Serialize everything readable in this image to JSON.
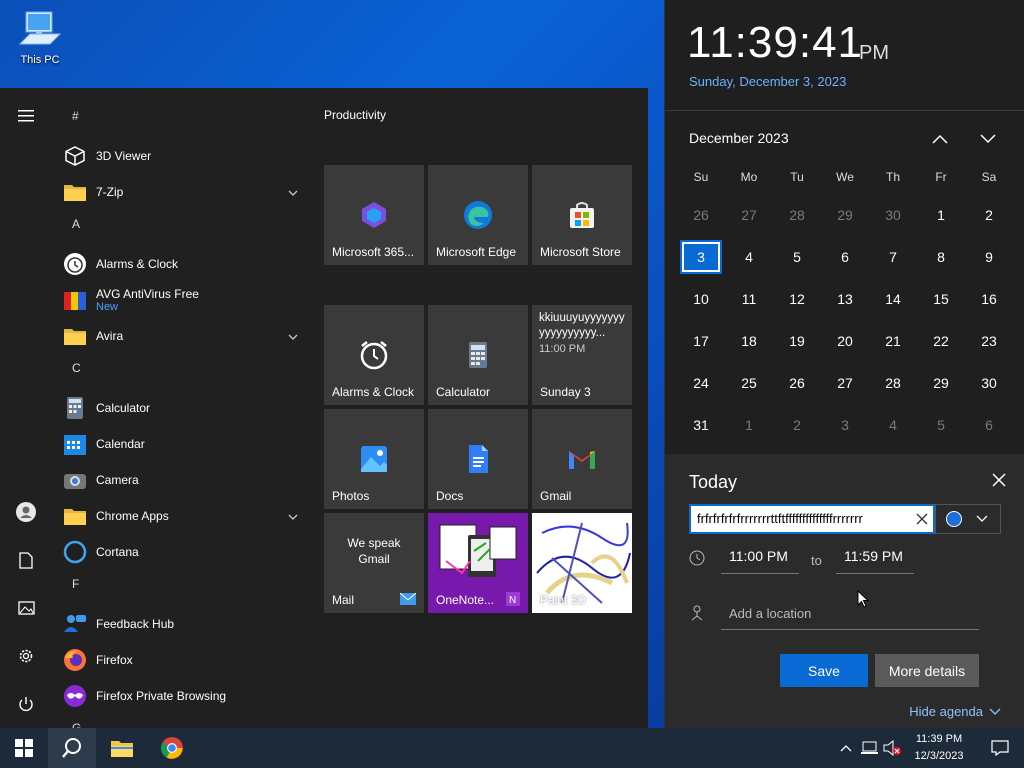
{
  "desktop": {
    "icon_label": "This PC"
  },
  "start_menu": {
    "groups": [
      {
        "letter": "#",
        "apps": [
          {
            "label": "3D Viewer",
            "icon": "cube-icon"
          },
          {
            "label": "7-Zip",
            "icon": "folder-icon",
            "expandable": true
          }
        ]
      },
      {
        "letter": "A",
        "apps": [
          {
            "label": "Alarms & Clock",
            "icon": "alarm-clock-icon"
          },
          {
            "label": "AVG AntiVirus Free",
            "sublabel": "New",
            "icon": "avg-icon"
          },
          {
            "label": "Avira",
            "icon": "folder-icon",
            "expandable": true
          }
        ]
      },
      {
        "letter": "C",
        "apps": [
          {
            "label": "Calculator",
            "icon": "calculator-icon"
          },
          {
            "label": "Calendar",
            "icon": "calendar-icon"
          },
          {
            "label": "Camera",
            "icon": "camera-icon"
          },
          {
            "label": "Chrome Apps",
            "icon": "folder-icon",
            "expandable": true
          },
          {
            "label": "Cortana",
            "icon": "cortana-icon"
          }
        ]
      },
      {
        "letter": "F",
        "apps": [
          {
            "label": "Feedback Hub",
            "icon": "feedback-icon"
          },
          {
            "label": "Firefox",
            "icon": "firefox-icon"
          },
          {
            "label": "Firefox Private Browsing",
            "icon": "firefox-private-icon"
          }
        ]
      },
      {
        "letter": "G",
        "apps": []
      }
    ],
    "tiles_group_title": "Productivity",
    "tiles": {
      "m365": "Microsoft 365...",
      "edge": "Microsoft Edge",
      "store": "Microsoft Store",
      "alarms": "Alarms & Clock",
      "calculator": "Calculator",
      "cal_event_title": "kkiuuuyuyyyyyyyyyyyyyyyyy...",
      "cal_event_time": "11:00 PM",
      "cal_day": "Sunday 3",
      "photos": "Photos",
      "docs": "Docs",
      "gmail": "Gmail",
      "mail_promo": "We speak Gmail",
      "mail": "Mail",
      "onenote": "OneNote...",
      "paint3d": "Paint 3D"
    }
  },
  "clock": {
    "time": "11:39:41",
    "ampm": "PM",
    "long_date": "Sunday, December 3, 2023"
  },
  "calendar": {
    "month_label": "December 2023",
    "weekdays": [
      "Su",
      "Mo",
      "Tu",
      "We",
      "Th",
      "Fr",
      "Sa"
    ],
    "days": [
      {
        "d": "26",
        "o": true
      },
      {
        "d": "27",
        "o": true
      },
      {
        "d": "28",
        "o": true
      },
      {
        "d": "29",
        "o": true
      },
      {
        "d": "30",
        "o": true
      },
      {
        "d": "1"
      },
      {
        "d": "2"
      },
      {
        "d": "3",
        "t": true
      },
      {
        "d": "4"
      },
      {
        "d": "5"
      },
      {
        "d": "6"
      },
      {
        "d": "7"
      },
      {
        "d": "8"
      },
      {
        "d": "9"
      },
      {
        "d": "10"
      },
      {
        "d": "11"
      },
      {
        "d": "12"
      },
      {
        "d": "13"
      },
      {
        "d": "14"
      },
      {
        "d": "15"
      },
      {
        "d": "16"
      },
      {
        "d": "17"
      },
      {
        "d": "18"
      },
      {
        "d": "19"
      },
      {
        "d": "20"
      },
      {
        "d": "21"
      },
      {
        "d": "22"
      },
      {
        "d": "23"
      },
      {
        "d": "24"
      },
      {
        "d": "25"
      },
      {
        "d": "26"
      },
      {
        "d": "27"
      },
      {
        "d": "28"
      },
      {
        "d": "29"
      },
      {
        "d": "30"
      },
      {
        "d": "31"
      },
      {
        "d": "1",
        "o": true
      },
      {
        "d": "2",
        "o": true
      },
      {
        "d": "3",
        "o": true
      },
      {
        "d": "4",
        "o": true
      },
      {
        "d": "5",
        "o": true
      },
      {
        "d": "6",
        "o": true
      }
    ]
  },
  "agenda": {
    "title": "Today",
    "event_text": "frfrfrfrfrfrrrrrrrttftffffffffffffffrrrrrrr",
    "start_time": "11:00 PM",
    "to_label": "to",
    "end_time": "11:59 PM",
    "location_placeholder": "Add a location",
    "save_label": "Save",
    "details_label": "More details",
    "hide_label": "Hide agenda",
    "event_color": "#1e6fd9"
  },
  "taskbar": {
    "tray_time": "11:39 PM",
    "tray_date": "12/3/2023"
  }
}
